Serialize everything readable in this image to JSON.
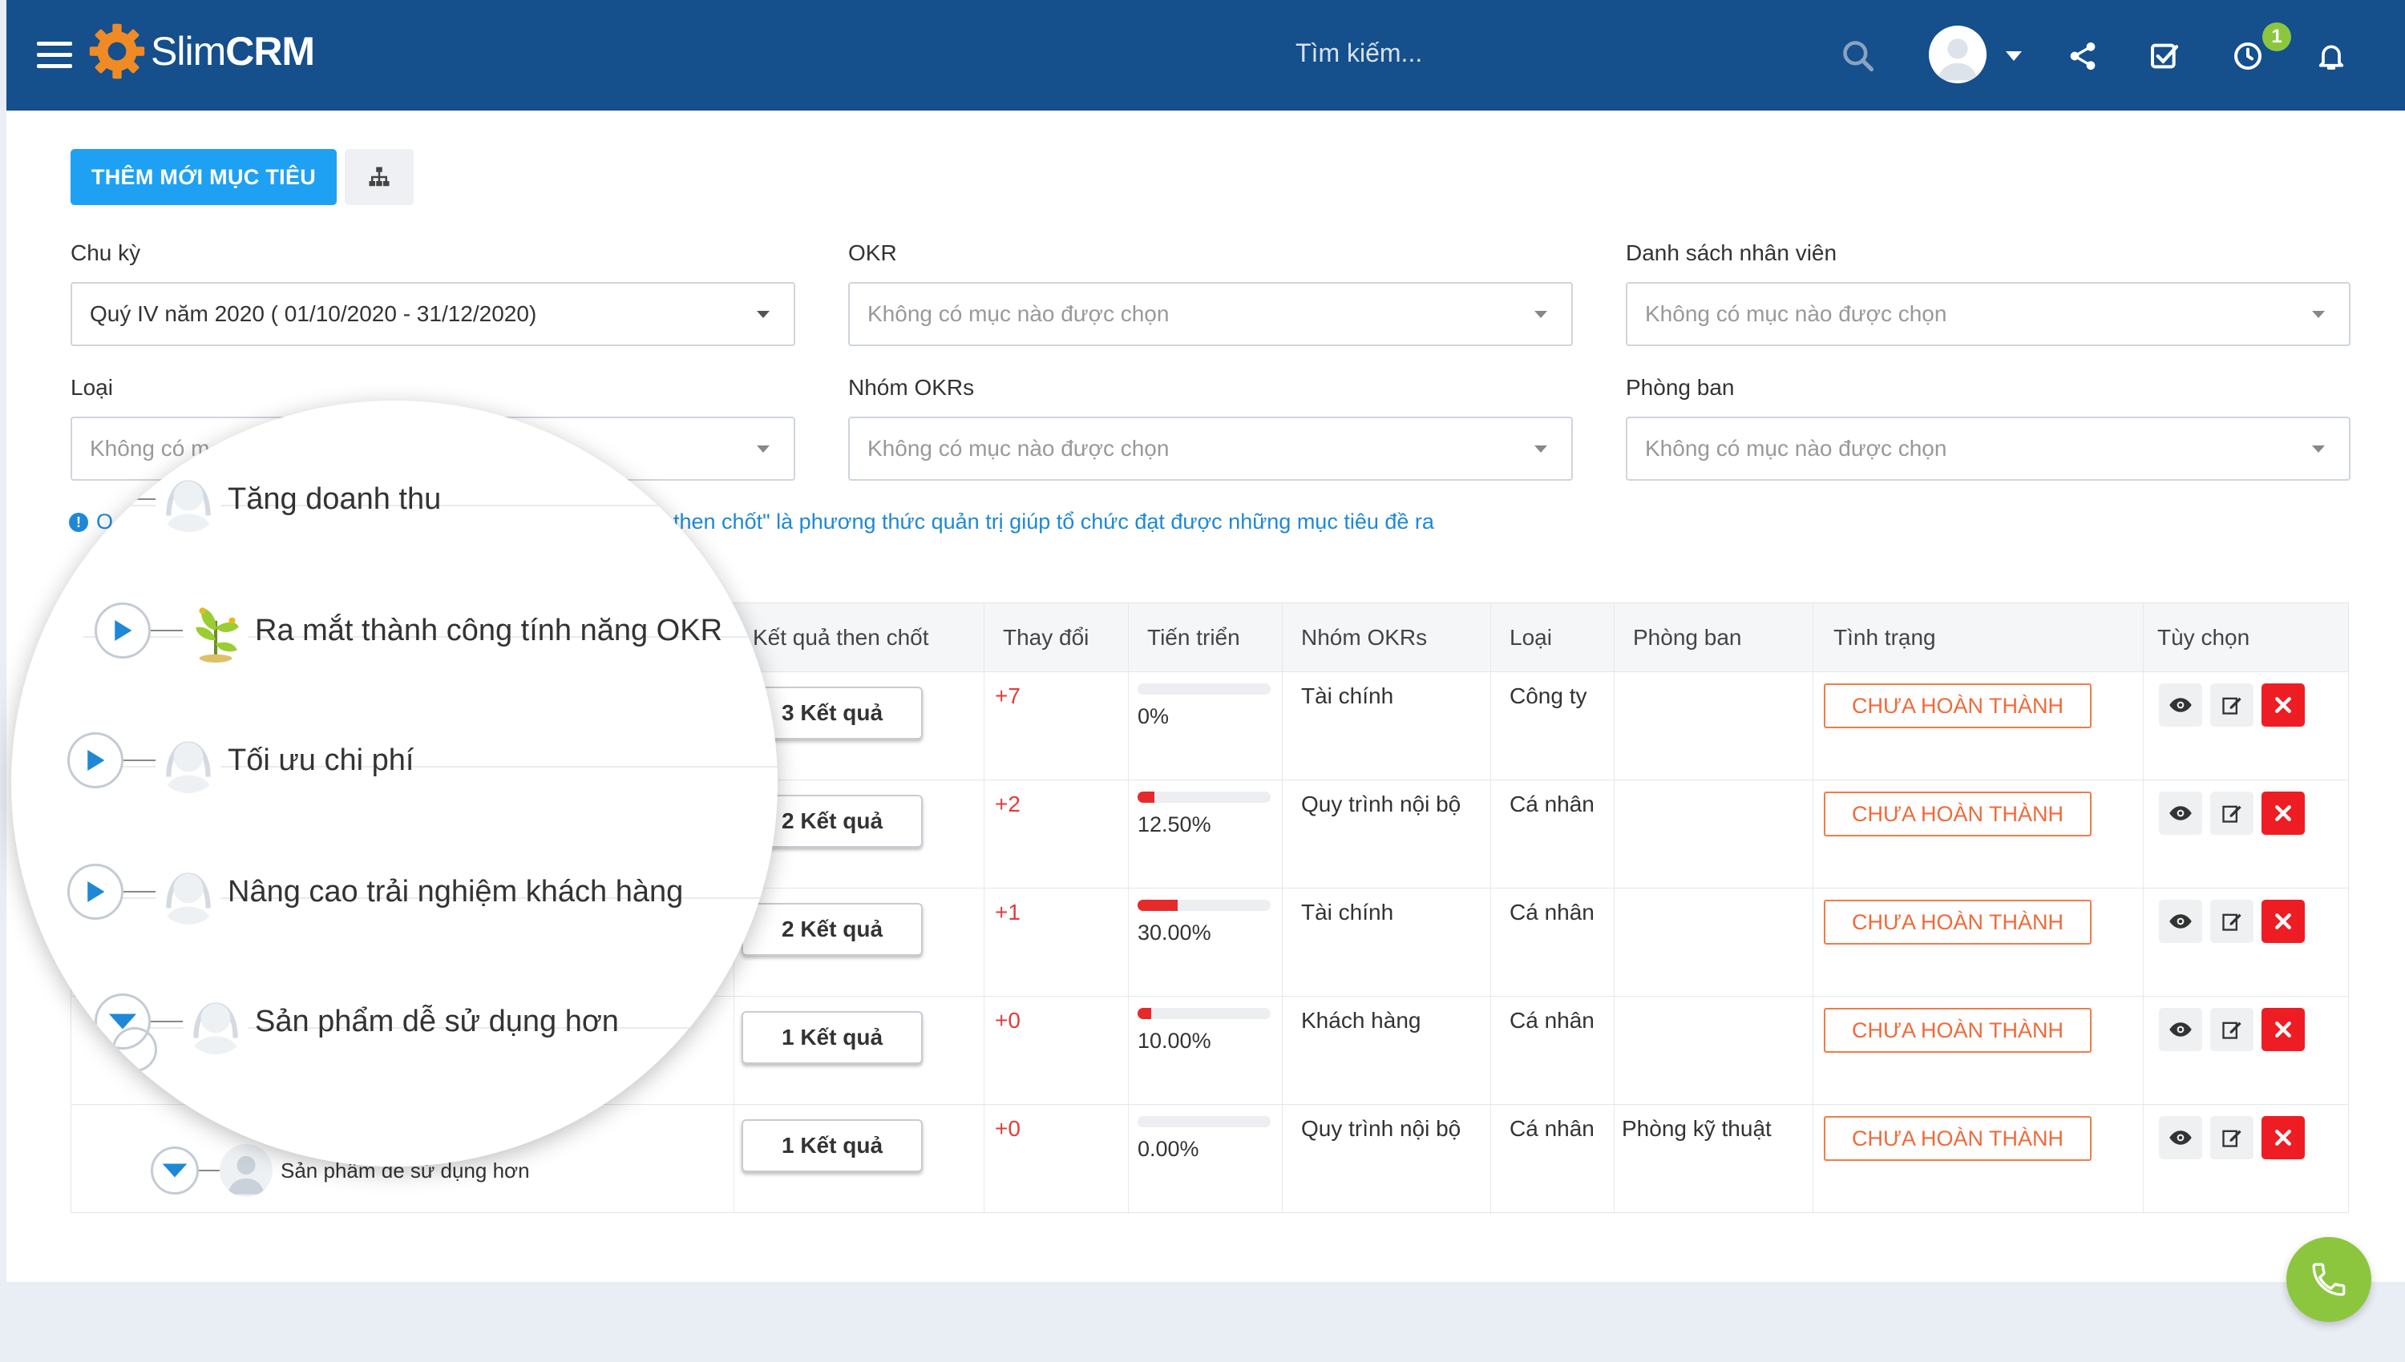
{
  "app": {
    "name_light": "Slim",
    "name_bold": "CRM"
  },
  "header": {
    "search_placeholder": "Tìm kiếm...",
    "notification_count": "1"
  },
  "toolbar": {
    "add_label": "THÊM MỚI MỤC TIÊU"
  },
  "filters": {
    "chu_ky": {
      "label": "Chu kỳ",
      "value": "Quý IV năm 2020 ( 01/10/2020 - 31/12/2020)"
    },
    "okr": {
      "label": "OKR",
      "placeholder": "Không có mục nào được chọn"
    },
    "nhan_vien": {
      "label": "Danh sách nhân viên",
      "placeholder": "Không có mục nào được chọn"
    },
    "loai": {
      "label": "Loại",
      "placeholder": "Không có m"
    },
    "nhom": {
      "label": "Nhóm OKRs",
      "placeholder": "Không có mục nào được chọn"
    },
    "phong_ban": {
      "label": "Phòng ban",
      "placeholder": "Không có mục nào được chọn"
    }
  },
  "info": {
    "prefix": "O",
    "text": "then chốt\" là phương thức quản trị giúp tổ chức đạt được những mục tiêu đề ra"
  },
  "table": {
    "headers": [
      "Kết quả then chốt",
      "Thay đổi",
      "Tiến triển",
      "Nhóm OKRs",
      "Loại",
      "Phòng ban",
      "Tình trạng",
      "Tùy chọn"
    ],
    "rows": [
      {
        "ket_qua": "3 Kết quả",
        "change": "+7",
        "progress_text": "0%",
        "progress": 0,
        "nhom": "Tài chính",
        "loai": "Công ty",
        "phong_ban": "",
        "status": "CHƯA HOÀN THÀNH"
      },
      {
        "ket_qua": "2 Kết quả",
        "change": "+2",
        "progress_text": "12.50%",
        "progress": 12.5,
        "nhom": "Quy trình nội bộ",
        "loai": "Cá nhân",
        "phong_ban": "",
        "status": "CHƯA HOÀN THÀNH"
      },
      {
        "ket_qua": "2 Kết quả",
        "change": "+1",
        "progress_text": "30.00%",
        "progress": 30,
        "nhom": "Tài chính",
        "loai": "Cá nhân",
        "phong_ban": "",
        "status": "CHƯA HOÀN THÀNH"
      },
      {
        "ket_qua": "1 Kết quả",
        "change": "+0",
        "progress_text": "10.00%",
        "progress": 10,
        "nhom": "Khách hàng",
        "loai": "Cá nhân",
        "phong_ban": "",
        "status": "CHƯA HOÀN THÀNH"
      },
      {
        "ket_qua": "1 Kết quả",
        "change": "+0",
        "progress_text": "0.00%",
        "progress": 0,
        "nhom": "Quy trình nội bộ",
        "loai": "Cá nhân",
        "phong_ban": "Phòng kỹ thuật",
        "status": "CHƯA HOÀN THÀNH"
      }
    ],
    "bottom_objective": "Sản phẩm dễ sử dụng hơn"
  },
  "zoom": {
    "objectives": [
      {
        "name": "Tăng doanh thu"
      },
      {
        "name": "Ra mắt thành công tính năng OKR"
      },
      {
        "name": "Tối ưu chi phí"
      },
      {
        "name": "Nâng cao trải nghiệm khách hàng"
      },
      {
        "name": "Sản phẩm dễ sử dụng hơn"
      }
    ]
  },
  "colors": {
    "header": "#154f8c",
    "accent": "#1ea1f2",
    "status": "#f06a3a",
    "danger": "#ee1d24",
    "phone": "#8cc63f"
  }
}
